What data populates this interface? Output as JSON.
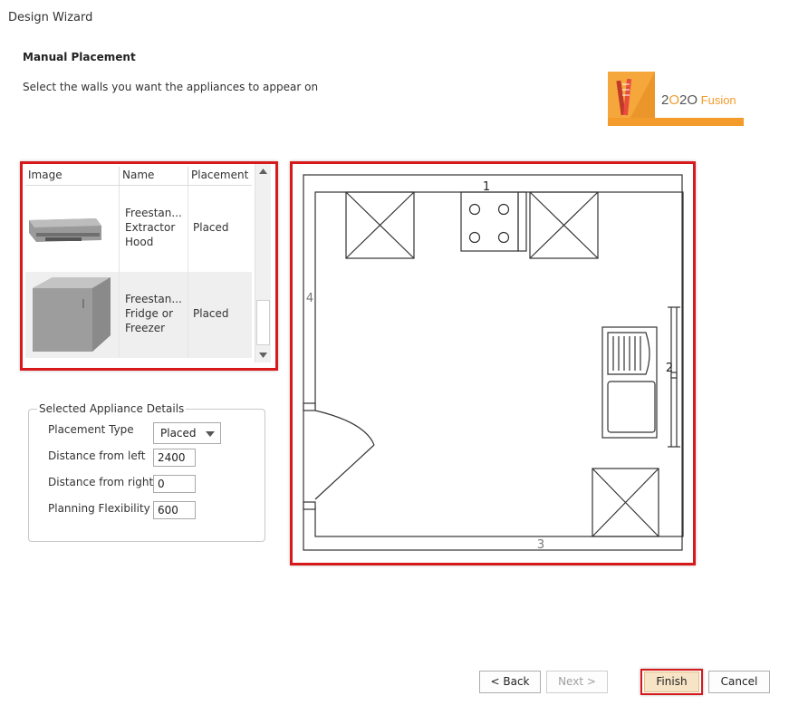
{
  "window": {
    "title": "Design Wizard"
  },
  "header": {
    "title": "Manual Placement",
    "instruction": "Select the walls you want the appliances to appear on"
  },
  "logo": {
    "text_a": "2",
    "text_o": "O",
    "text_b": "2O",
    "text_c": " Fusion",
    "accent": "#f39c2b"
  },
  "appliance_list": {
    "columns": [
      "Image",
      "Name",
      "Placement"
    ],
    "rows": [
      {
        "name": "Freestan...\nExtractor\nHood",
        "placement": "Placed",
        "image": "extractor-hood-thumbnail"
      },
      {
        "name": "Freestan...\nFridge or\nFreezer",
        "placement": "Placed",
        "image": "fridge-thumbnail"
      }
    ]
  },
  "details": {
    "legend": "Selected Appliance Details",
    "placement_type_label": "Placement Type",
    "placement_type_value": "Placed",
    "distance_left_label": "Distance from left",
    "distance_left_value": "2400",
    "distance_right_label": "Distance from right",
    "distance_right_value": "0",
    "flexibility_label": "Planning Flexibility",
    "flexibility_value": "600"
  },
  "floor_plan": {
    "wall_labels": {
      "top": "1",
      "right": "2",
      "bottom": "3",
      "left": "4"
    }
  },
  "buttons": {
    "back": "< Back",
    "next": "Next >",
    "finish": "Finish",
    "cancel": "Cancel"
  },
  "colors": {
    "highlight": "#d7191c",
    "finish_bg": "#f7e3c5"
  }
}
